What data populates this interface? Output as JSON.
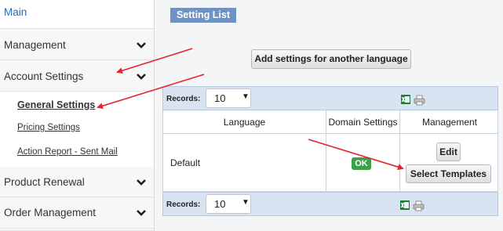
{
  "sidebar": {
    "main": "Main",
    "items": [
      {
        "label": "Management",
        "icon": "chevron-down-icon"
      },
      {
        "label": "Account Settings",
        "icon": "chevron-down-icon"
      },
      {
        "label": "Product Renewal",
        "icon": "chevron-down-icon"
      },
      {
        "label": "Order Management",
        "icon": "chevron-down-icon"
      }
    ],
    "submenu": [
      {
        "label": "General Settings",
        "active": true
      },
      {
        "label": "Pricing Settings"
      },
      {
        "label": "Action Report - Sent Mail"
      }
    ]
  },
  "main": {
    "title": "Setting List",
    "add_button": "Add settings for another language",
    "records_label": "Records:",
    "records_value": "10",
    "columns": [
      "Language",
      "Domain Settings",
      "Management"
    ],
    "rows": [
      {
        "language": "Default",
        "domain_status": "OK",
        "actions": [
          "Edit",
          "Select Templates"
        ]
      }
    ],
    "export_icon": "excel-icon",
    "print_icon": "printer-icon"
  },
  "colors": {
    "title_bg": "#6f92c4",
    "link": "#2a6ab5",
    "ok_badge": "#3f9e4a",
    "annotation_arrow": "#e3242b",
    "records_bar": "#d9e4f3"
  }
}
